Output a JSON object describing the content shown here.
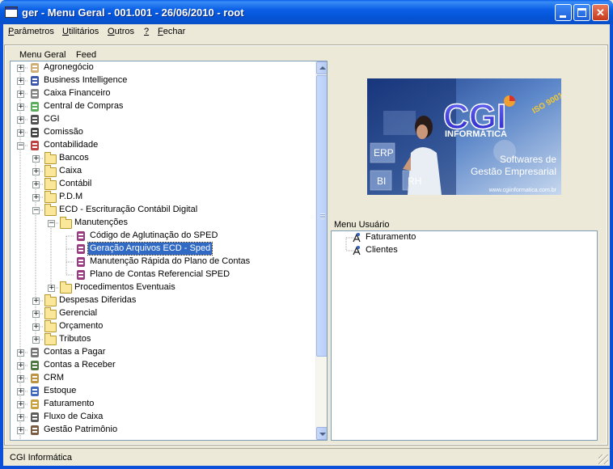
{
  "window": {
    "title": "ger - Menu Geral - 001.001 - 26/06/2010 - root"
  },
  "menubar": {
    "items": [
      {
        "u": "P",
        "rest": "arâmetros"
      },
      {
        "u": "U",
        "rest": "tilitários"
      },
      {
        "u": "O",
        "rest": "utros"
      },
      {
        "u": "?",
        "rest": ""
      },
      {
        "u": "F",
        "rest": "echar"
      }
    ]
  },
  "tabs": {
    "menu_geral": "Menu Geral",
    "feed": "Feed"
  },
  "tree": {
    "nodes": [
      {
        "label": "Agronegócio",
        "level": 0,
        "expander": "+",
        "icon": "agro-icon"
      },
      {
        "label": "Business Intelligence",
        "level": 0,
        "expander": "+",
        "icon": "bi-icon"
      },
      {
        "label": "Caixa Financeiro",
        "level": 0,
        "expander": "+",
        "icon": "cash-register-icon"
      },
      {
        "label": "Central de Compras",
        "level": 0,
        "expander": "+",
        "icon": "purchases-icon"
      },
      {
        "label": "CGI",
        "level": 0,
        "expander": "+",
        "icon": "cgi-icon"
      },
      {
        "label": "Comissão",
        "level": 0,
        "expander": "+",
        "icon": "percent-icon"
      },
      {
        "label": "Contabilidade",
        "level": 0,
        "expander": "−",
        "icon": "accounting-icon"
      },
      {
        "label": "Bancos",
        "level": 1,
        "expander": "+",
        "icon": "folder-icon"
      },
      {
        "label": "Caixa",
        "level": 1,
        "expander": "+",
        "icon": "folder-icon"
      },
      {
        "label": "Contábil",
        "level": 1,
        "expander": "+",
        "icon": "folder-icon"
      },
      {
        "label": "P.D.M",
        "level": 1,
        "expander": "+",
        "icon": "folder-icon"
      },
      {
        "label": "ECD - Escrituração Contábil Digital",
        "level": 1,
        "expander": "−",
        "icon": "folder-icon"
      },
      {
        "label": "Manutenções",
        "level": 2,
        "expander": "−",
        "icon": "folder-icon"
      },
      {
        "label": "Código de Aglutinação do SPED",
        "level": 3,
        "expander": "",
        "icon": "program-icon"
      },
      {
        "label": "Geração Arquivos ECD - Sped",
        "level": 3,
        "expander": "",
        "icon": "program-icon",
        "selected": true
      },
      {
        "label": "Manutenção Rápida do Plano de Contas",
        "level": 3,
        "expander": "",
        "icon": "program-icon"
      },
      {
        "label": "Plano de Contas Referencial SPED",
        "level": 3,
        "expander": "",
        "icon": "program-icon"
      },
      {
        "label": "Procedimentos Eventuais",
        "level": 2,
        "expander": "+",
        "icon": "folder-icon"
      },
      {
        "label": "Despesas Diferidas",
        "level": 1,
        "expander": "+",
        "icon": "folder-icon"
      },
      {
        "label": "Gerencial",
        "level": 1,
        "expander": "+",
        "icon": "folder-icon"
      },
      {
        "label": "Orçamento",
        "level": 1,
        "expander": "+",
        "icon": "folder-icon"
      },
      {
        "label": "Tributos",
        "level": 1,
        "expander": "+",
        "icon": "folder-icon"
      },
      {
        "label": "Contas a Pagar",
        "level": 0,
        "expander": "+",
        "icon": "payables-icon"
      },
      {
        "label": "Contas a Receber",
        "level": 0,
        "expander": "+",
        "icon": "receivables-icon"
      },
      {
        "label": "CRM",
        "level": 0,
        "expander": "+",
        "icon": "crm-icon"
      },
      {
        "label": "Estoque",
        "level": 0,
        "expander": "+",
        "icon": "inventory-icon"
      },
      {
        "label": "Faturamento",
        "level": 0,
        "expander": "+",
        "icon": "billing-icon"
      },
      {
        "label": "Fluxo de Caixa",
        "level": 0,
        "expander": "+",
        "icon": "cashflow-icon"
      },
      {
        "label": "Gestão Patrimônio",
        "level": 0,
        "expander": "+",
        "icon": "assets-icon"
      }
    ]
  },
  "logo": {
    "brand": "CGI",
    "brand_sub": "INFORMÁTICA",
    "iso": "ISO 9001",
    "tag_erp": "ERP",
    "tag_bi": "BI",
    "tag_rh": "RH",
    "tagline_1": "Softwares de",
    "tagline_2": "Gestão Empresarial",
    "url": "www.cgiinformatica.com.br"
  },
  "user_menu": {
    "label": "Menu Usuário",
    "items": [
      {
        "label": "Faturamento",
        "icon": "shortcut-icon"
      },
      {
        "label": "Clientes",
        "icon": "shortcut-icon"
      }
    ]
  },
  "statusbar": {
    "text": "CGI Informática"
  },
  "colors": {
    "title_blue": "#0a5fe6",
    "selection": "#316ac5",
    "face": "#ece9d8"
  }
}
